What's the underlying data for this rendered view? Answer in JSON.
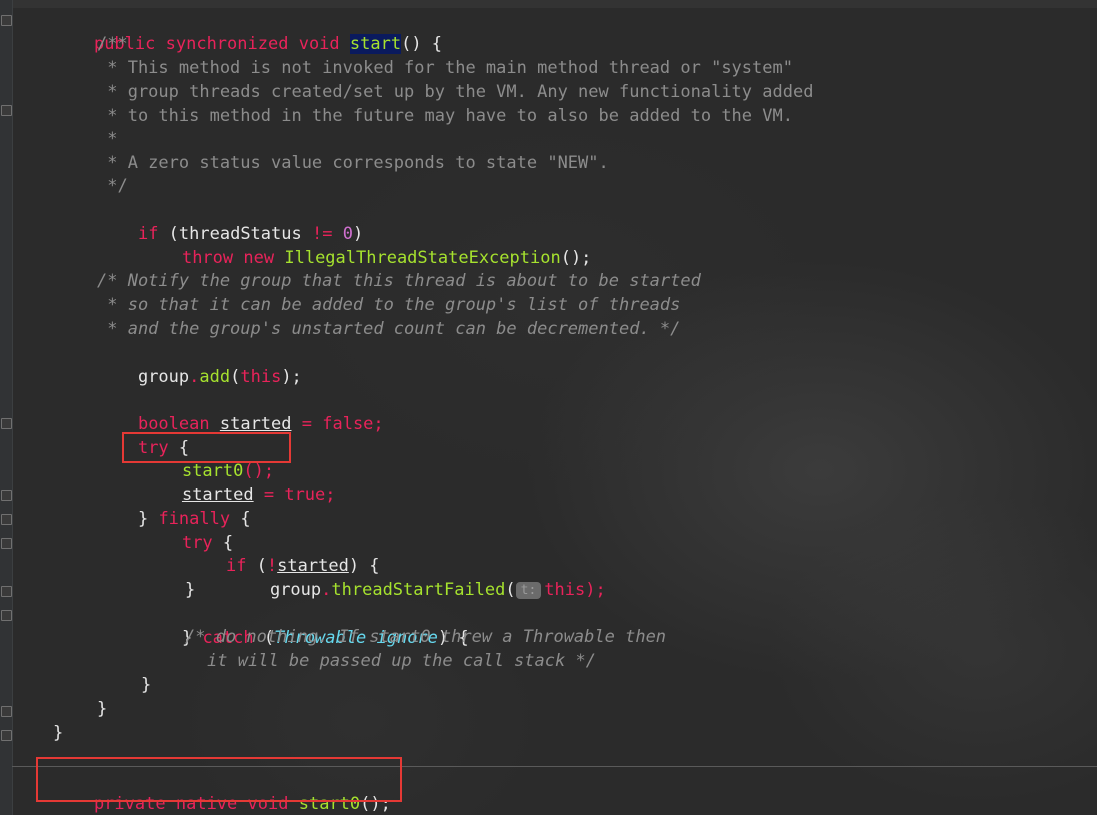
{
  "code": {
    "l1": {
      "kw1": "public",
      "kw2": "synchronized",
      "kw3": "void",
      "fn": "start",
      "rest": "() {"
    },
    "c1": "/**",
    "c2": " * This method is not invoked for the main method thread or \"system\"",
    "c3": " * group threads created/set up by the VM. Any new functionality added",
    "c4": " * to this method in the future may have to also be added to the VM.",
    "c5": " *",
    "c6": " * A zero status value corresponds to state \"NEW\".",
    "c7": " */",
    "if1": {
      "kw": "if",
      "a": " (threadStatus ",
      "op": "!=",
      "num": "0",
      "b": ")"
    },
    "throw1": {
      "kw1": "throw",
      "kw2": "new",
      "fn": "IllegalThreadStateException",
      "rest": "();"
    },
    "n1": "/* Notify the group that this thread is about to be started",
    "n2": " * so that it can be added to the group's list of threads",
    "n3": " * and the group's unstarted count can be decremented. */",
    "add1": {
      "obj": "group",
      "dot": ".",
      "fn": "add",
      "p1": "(",
      "kw": "this",
      "p2": ");"
    },
    "bool1": {
      "kw": "boolean",
      "var": "started",
      "eq": " = ",
      "val": "false",
      "semi": ";"
    },
    "try1": {
      "kw": "try",
      "rest": " {"
    },
    "call1": {
      "fn": "start0",
      "rest": "();"
    },
    "set1": {
      "var": "started",
      "eq": " = ",
      "val": "true",
      "semi": ";"
    },
    "fin1": {
      "pre": "} ",
      "kw": "finally",
      "rest": " {"
    },
    "try2": {
      "kw": "try",
      "rest": " {"
    },
    "if2": {
      "kw": "if",
      "a": " (",
      "op": "!",
      "var": "started",
      "b": ") {"
    },
    "fail1": {
      "obj": "group",
      "dot": ".",
      "fn": "threadStartFailed",
      "p1": "(",
      "hint": "t:",
      "kw": "this",
      "p2": ");"
    },
    "close1": "}",
    "catch1": {
      "pre": "} ",
      "kw": "catch",
      "a": " (",
      "ty": "Throwable",
      "sp": " ",
      "var": "ignore",
      "b": ") {"
    },
    "d1": "/* do nothing. If start0 threw a Throwable then",
    "d2": "it will be passed up the call stack */",
    "close2": "}",
    "close3": "}",
    "close4": "}",
    "native1": {
      "kw1": "private",
      "kw2": "native",
      "kw3": "void",
      "fn": "start0",
      "rest": "();"
    }
  }
}
